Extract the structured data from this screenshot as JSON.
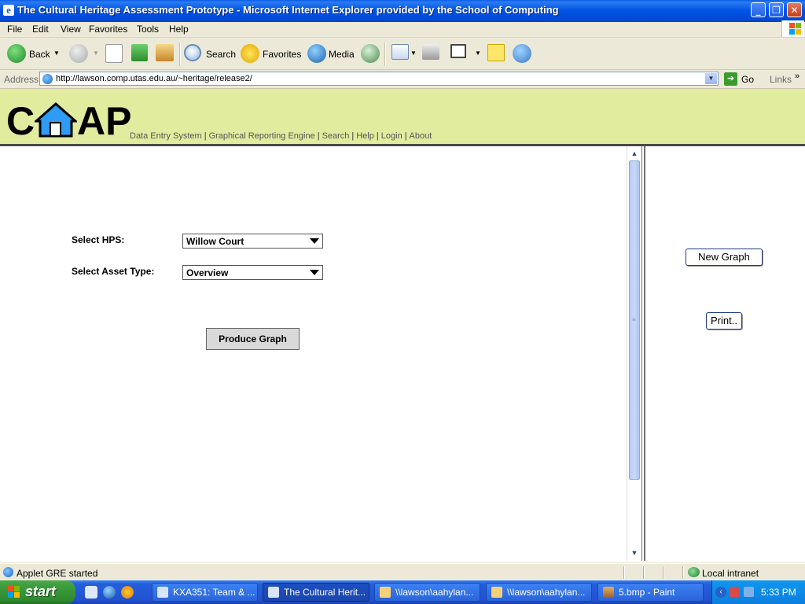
{
  "window": {
    "title": "The Cultural Heritage Assessment Prototype - Microsoft Internet Explorer provided by the School of Computing",
    "controls": {
      "minimize": "_",
      "maximize": "❐",
      "close": "✕"
    }
  },
  "menubar": {
    "items": [
      "File",
      "Edit",
      "View",
      "Favorites",
      "Tools",
      "Help"
    ]
  },
  "toolbar": {
    "back": "Back",
    "search": "Search",
    "favorites": "Favorites",
    "media": "Media"
  },
  "address": {
    "label": "Address",
    "url": "http://lawson.comp.utas.edu.au/~heritage/release2/",
    "go": "Go",
    "links": "Links"
  },
  "site": {
    "logo_letters": [
      "C",
      "AP"
    ],
    "nav": [
      "Data Entry System",
      "Graphical Reporting Engine",
      "Search",
      "Help",
      "Login",
      "About"
    ],
    "nav_separator": "|",
    "header_color": "#e1ec9f"
  },
  "applet": {
    "hps_label": "Select HPS:",
    "hps_value": "Willow Court",
    "asset_label": "Select Asset Type:",
    "asset_value": "Overview",
    "produce_button": "Produce Graph",
    "new_graph_button": "New Graph",
    "print_button": "Print.."
  },
  "status": {
    "text": "Applet GRE started",
    "zone": "Local intranet"
  },
  "taskbar": {
    "start": "start",
    "tasks": [
      {
        "label": "KXA351: Team & ...",
        "active": false
      },
      {
        "label": "The Cultural Herit...",
        "active": true
      },
      {
        "label": "\\\\lawson\\aahylan...",
        "active": false
      },
      {
        "label": "\\\\lawson\\aahylan...",
        "active": false
      },
      {
        "label": "5.bmp - Paint",
        "active": false
      }
    ],
    "clock": "5:33 PM"
  }
}
